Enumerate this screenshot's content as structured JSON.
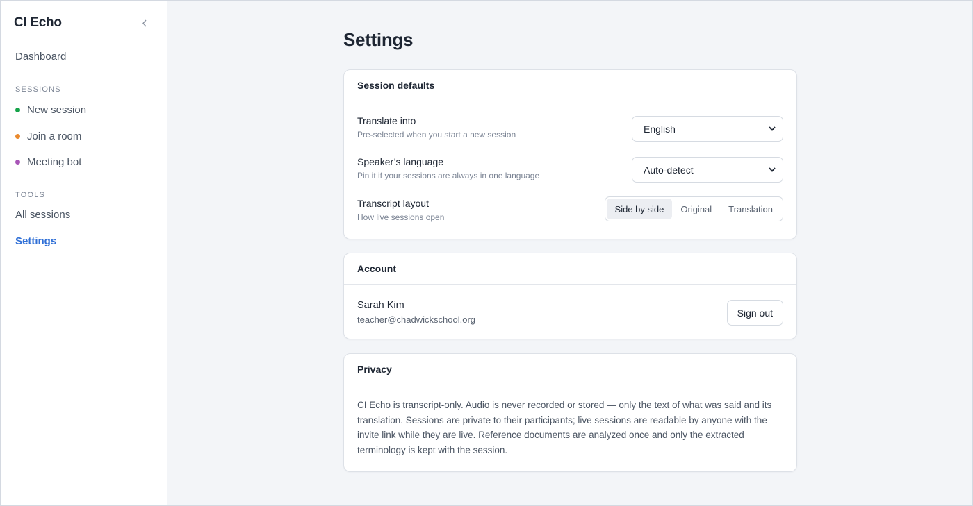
{
  "app": {
    "title": "CI Echo",
    "collapse_icon": "chevron-left-icon"
  },
  "sidebar": {
    "dashboard": "Dashboard",
    "sessions_label": "SESSIONS",
    "sessions": [
      {
        "label": "New session",
        "dot_color": "#16a34a"
      },
      {
        "label": "Join a room",
        "dot_color": "#ea8a2e"
      },
      {
        "label": "Meeting bot",
        "dot_color": "#a855b7"
      }
    ],
    "tools_label": "TOOLS",
    "tools": [
      {
        "label": "All sessions"
      },
      {
        "label": "Settings",
        "active": true
      }
    ],
    "accent_color": "#2f6fd6"
  },
  "page": {
    "title": "Settings"
  },
  "session_defaults": {
    "header": "Session defaults",
    "translate_into": {
      "title": "Translate into",
      "subtitle": "Pre-selected when you start a new session",
      "value": "English"
    },
    "speaker_language": {
      "title": "Speaker’s language",
      "subtitle": "Pin it if your sessions are always in one language",
      "value": "Auto-detect"
    },
    "transcript_layout": {
      "title": "Transcript layout",
      "subtitle": "How live sessions open",
      "options": [
        "Side by side",
        "Original",
        "Translation"
      ],
      "selected": "Side by side"
    }
  },
  "account": {
    "header": "Account",
    "name": "Sarah Kim",
    "email": "teacher@chadwickschool.org",
    "sign_out_label": "Sign out"
  },
  "privacy": {
    "header": "Privacy",
    "text": "CI Echo is transcript-only. Audio is never recorded or stored — only the text of what was said and its translation. Sessions are private to their participants; live sessions are readable by anyone with the invite link while they are live. Reference documents are analyzed once and only the extracted terminology is kept with the session."
  }
}
